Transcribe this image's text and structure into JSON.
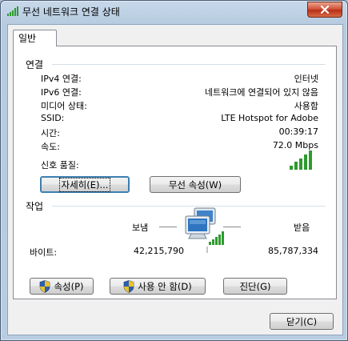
{
  "window": {
    "title": "무선 네트워크 연결 상태",
    "close_label": "✕"
  },
  "tabs": [
    {
      "label": "일반"
    }
  ],
  "connection": {
    "header": "연결",
    "rows": [
      {
        "label": "IPv4 연결:",
        "value": "인터넷"
      },
      {
        "label": "IPv6 연결:",
        "value": "네트워크에 연결되어 있지 않음"
      },
      {
        "label": "미디어 상태:",
        "value": "사용함"
      },
      {
        "label": "SSID:",
        "value": "LTE Hotspot for Adobe"
      },
      {
        "label": "시간:",
        "value": "00:39:17"
      },
      {
        "label": "속도:",
        "value": "72.0 Mbps"
      }
    ],
    "signal_label": "신호 품질:",
    "signal_bars": 5,
    "signal_max": 5,
    "details_button": "자세히(E)...",
    "wireless_props_button": "무선 속성(W)"
  },
  "activity": {
    "header": "작업",
    "sent_label": "보냄",
    "received_label": "받음",
    "bytes_label": "바이트:",
    "bytes_sent": "42,215,790",
    "bytes_received": "85,787,334"
  },
  "buttons": {
    "properties": "속성(P)",
    "disable": "사용 안 함(D)",
    "diagnose": "진단(G)",
    "close": "닫기(C)"
  },
  "colors": {
    "signal_green": "#2e9a2e",
    "shield_blue": "#2f5fb3",
    "shield_yellow": "#e8c22a"
  }
}
